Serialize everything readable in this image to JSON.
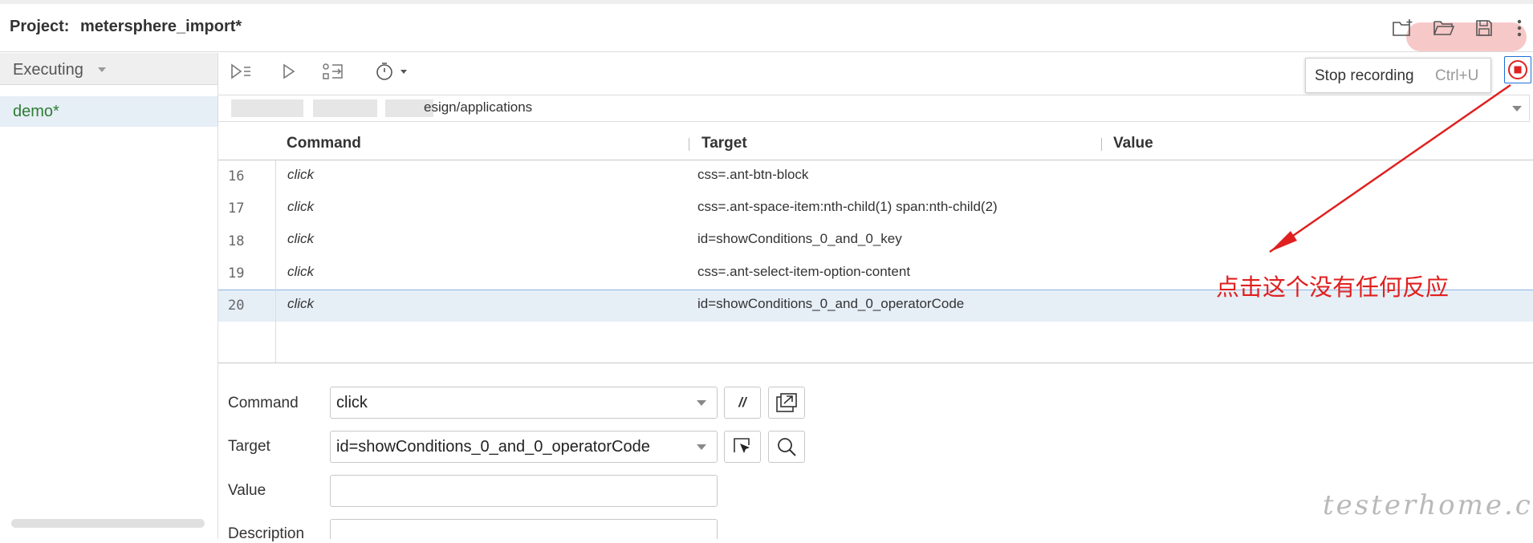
{
  "header": {
    "project_label": "Project:",
    "project_name": "metersphere_import*",
    "icons": [
      "new-folder-icon",
      "open-folder-icon",
      "save-icon",
      "kebab-menu-icon"
    ]
  },
  "sidebar": {
    "mode": "Executing",
    "tests": [
      {
        "label": "demo*",
        "selected": true
      }
    ]
  },
  "toolbar": {
    "icons": [
      "run-all-icon",
      "run-icon",
      "step-icon",
      "speed-icon"
    ]
  },
  "url_bar": {
    "value": "esign/applications"
  },
  "table": {
    "columns": [
      "Command",
      "Target",
      "Value"
    ],
    "rows": [
      {
        "num": "16",
        "command": "click",
        "target": "css=.ant-btn-block",
        "value": ""
      },
      {
        "num": "17",
        "command": "click",
        "target": "css=.ant-space-item:nth-child(1) span:nth-child(2)",
        "value": ""
      },
      {
        "num": "18",
        "command": "click",
        "target": "id=showConditions_0_and_0_key",
        "value": ""
      },
      {
        "num": "19",
        "command": "click",
        "target": "css=.ant-select-item-option-content",
        "value": ""
      },
      {
        "num": "20",
        "command": "click",
        "target": "id=showConditions_0_and_0_operatorCode",
        "value": "",
        "selected": true
      }
    ]
  },
  "editor": {
    "command_label": "Command",
    "command_value": "click",
    "comment_button": "//",
    "target_label": "Target",
    "target_value": "id=showConditions_0_and_0_operatorCode",
    "value_label": "Value",
    "value_value": "",
    "description_label": "Description"
  },
  "tooltip": {
    "text": "Stop recording",
    "shortcut": "Ctrl+U"
  },
  "annotation": {
    "text": "点击这个没有任何反应",
    "color": "#e02020"
  },
  "watermark": "testerhome.com",
  "colors": {
    "selected_row": "#e6eef6",
    "accent_blue": "#1e6fd9",
    "recording_red": "#e02020",
    "test_green": "#2e7d32"
  }
}
